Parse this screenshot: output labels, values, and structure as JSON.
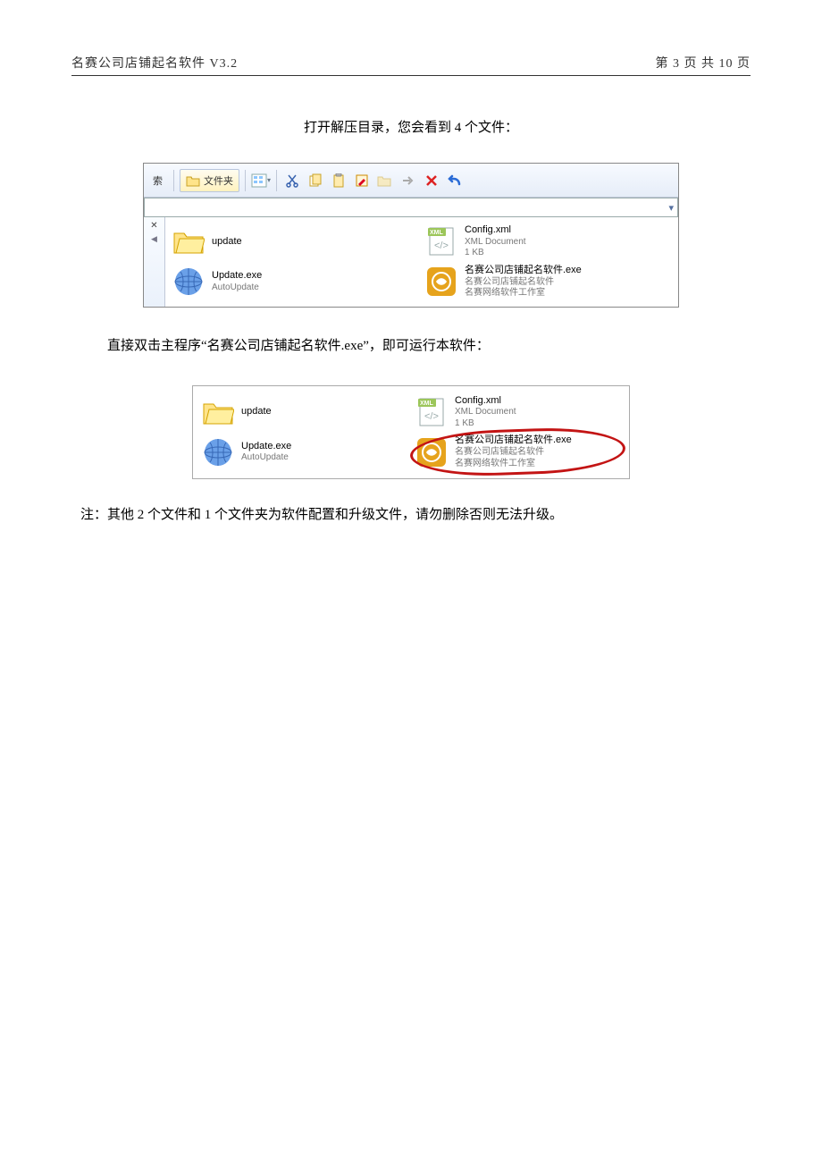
{
  "header": {
    "left": "名赛公司店铺起名软件 V3.2",
    "right": "第 3 页 共 10 页"
  },
  "intro": "打开解压目录，您会看到 4 个文件：",
  "toolbar": {
    "search": "索",
    "folders": "文件夹"
  },
  "files": {
    "update_folder": {
      "title": "update"
    },
    "config_xml": {
      "title": "Config.xml",
      "line2": "XML Document",
      "line3": "1 KB"
    },
    "update_exe": {
      "title": "Update.exe",
      "line2": "AutoUpdate"
    },
    "main_exe": {
      "title": "名赛公司店铺起名软件.exe",
      "line2": "名赛公司店铺起名软件",
      "line3": "名赛网络软件工作室"
    }
  },
  "body2": "直接双击主程序“名赛公司店铺起名软件.exe”，即可运行本软件：",
  "note": "注：其他 2 个文件和 1 个文件夹为软件配置和升级文件，请勿删除否则无法升级。"
}
